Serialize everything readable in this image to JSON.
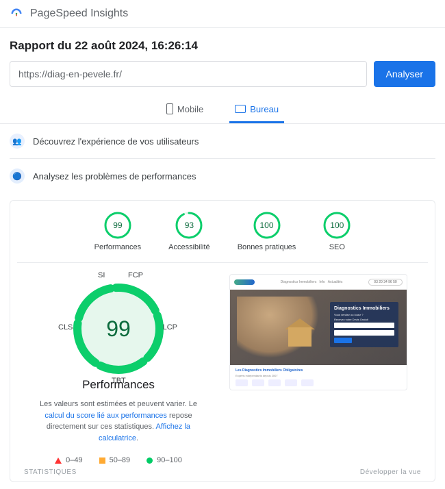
{
  "app_title": "PageSpeed Insights",
  "report_title": "Rapport du 22 août 2024, 16:26:14",
  "url_value": "https://diag-en-pevele.fr/",
  "analyze_label": "Analyser",
  "tabs": {
    "mobile": "Mobile",
    "desktop": "Bureau"
  },
  "section_experience": "Découvrez l'expérience de vos utilisateurs",
  "section_diagnostics": "Analysez les problèmes de performances",
  "gauges": [
    {
      "label": "Performances",
      "value": 99
    },
    {
      "label": "Accessibilité",
      "value": 93
    },
    {
      "label": "Bonnes pratiques",
      "value": 100
    },
    {
      "label": "SEO",
      "value": 100
    }
  ],
  "big_gauge": {
    "value": 99,
    "title": "Performances",
    "metrics": {
      "si": "SI",
      "fcp": "FCP",
      "lcp": "LCP",
      "tbt": "TBT",
      "cls": "CLS"
    }
  },
  "desc": {
    "pre": "Les valeurs sont estimées et peuvent varier. Le ",
    "link1": "calcul du score lié aux performances",
    "mid": " repose directement sur ces statistiques. ",
    "link2": "Affichez la calculatrice",
    "post": "."
  },
  "legend": {
    "r0": "0–49",
    "r1": "50–89",
    "r2": "90–100"
  },
  "screenshot": {
    "hero_title": "Diagnostics Immobiliers",
    "hero_sub1": "Vous vendez ou louez ?",
    "hero_sub2": "Recevez votre Devis Gratuit",
    "bottom_title": "Les Diagnostics Immobiliers Obligatoires",
    "bottom_sub": "Experts indépendants depuis 2007"
  },
  "footer": {
    "stats": "STATISTIQUES",
    "expand": "Développer la vue"
  }
}
